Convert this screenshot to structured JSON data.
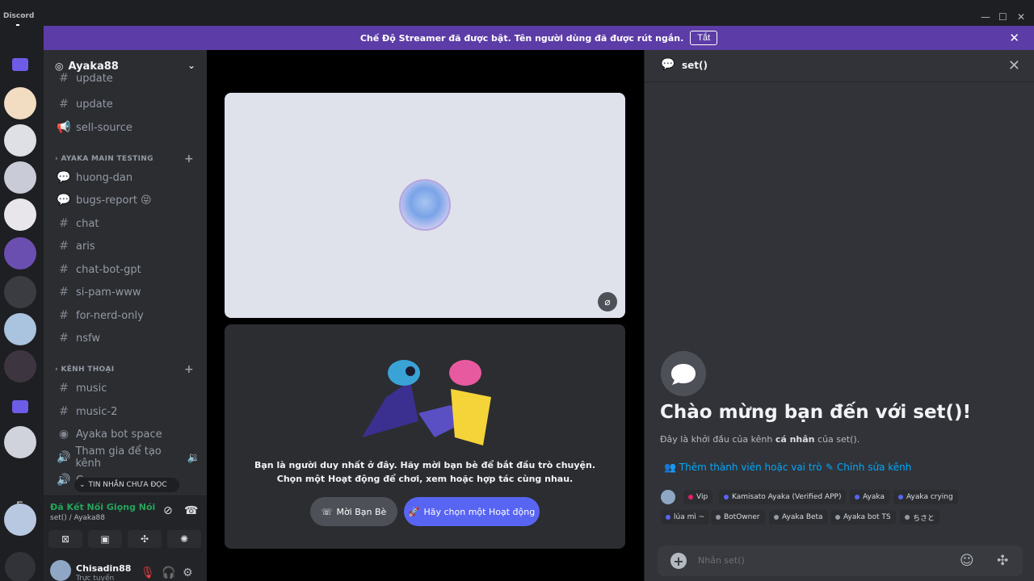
{
  "app": {
    "title": "Discord"
  },
  "banner": {
    "text": "Chế Độ Streamer đã được bật. Tên người dùng đã được rút ngắn.",
    "button": "Tắt"
  },
  "server": {
    "name": "Ayaka88"
  },
  "channels_top": [
    {
      "name": "update",
      "icon": "hash-icon"
    },
    {
      "name": "update",
      "icon": "hash-icon"
    },
    {
      "name": "sell-source",
      "icon": "announcement-icon"
    }
  ],
  "category1": {
    "label": "AYAKA MAIN TESTING"
  },
  "channels_main": [
    {
      "name": "huong-dan",
      "icon": "forum-icon"
    },
    {
      "name": "bugs-report 😝",
      "icon": "forum-icon"
    },
    {
      "name": "chat",
      "icon": "hash-icon"
    },
    {
      "name": "aris",
      "icon": "hash-icon"
    },
    {
      "name": "chat-bot-gpt",
      "icon": "hash-icon"
    },
    {
      "name": "si-pam-www",
      "icon": "hash-icon"
    },
    {
      "name": "for-nerd-only",
      "icon": "hash-icon"
    },
    {
      "name": "nsfw",
      "icon": "hash-icon"
    }
  ],
  "category2": {
    "label": "KÊNH THOẠI"
  },
  "channels_voice": [
    {
      "name": "music",
      "icon": "hash-icon"
    },
    {
      "name": "music-2",
      "icon": "hash-icon"
    },
    {
      "name": "Ayaka bot space",
      "icon": "stage-icon"
    },
    {
      "name": "Tham gia để tạo kênh",
      "icon": "speaker-icon"
    },
    {
      "name": "C...",
      "icon": "speaker-icon"
    }
  ],
  "unread_pill": "TIN NHẮN CHƯA ĐỌC",
  "voice": {
    "status": "Đã Kết Nối Giọng Nói",
    "location": "set() / Ayaka88"
  },
  "user": {
    "name": "Chisadin88",
    "status": "Trực tuyến"
  },
  "stage": {
    "invite_line1": "Bạn là người duy nhất ở đây. Hãy mời bạn bè để bắt đầu trò chuyện.",
    "invite_line2": "Chọn một Hoạt động để chơi, xem hoặc hợp tác cùng nhau.",
    "invite_button": "Mời Bạn Bè",
    "activity_button": "Hãy chọn một Hoạt động"
  },
  "chat": {
    "title": "set()",
    "welcome": "Chào mừng bạn đến với set()!",
    "welcome_sub_a": "Đây là khởi đầu của kênh ",
    "welcome_sub_b": "cá nhân",
    "welcome_sub_c": " của set().",
    "link_add": "Thêm thành viên hoặc vai trò",
    "link_edit": "Chỉnh sửa kênh",
    "placeholder": "Nhắn set()"
  },
  "roles": [
    {
      "name": "Vip",
      "color": "#e91e63"
    },
    {
      "name": "Kamisato Ayaka (Verified APP)",
      "color": "#5865f2"
    },
    {
      "name": "Ayaka",
      "color": "#5865f2"
    },
    {
      "name": "Ayaka crying",
      "color": "#5865f2"
    },
    {
      "name": "lúa mì ~",
      "color": "#5865f2"
    },
    {
      "name": "BotOwner",
      "color": "#949ba4"
    },
    {
      "name": "Ayaka Beta",
      "color": "#949ba4"
    },
    {
      "name": "Ayaka bot TS",
      "color": "#949ba4"
    },
    {
      "name": "ちさと",
      "color": "#949ba4"
    }
  ],
  "colors": {
    "accent": "#5865f2",
    "banner": "#5c3ca6",
    "online": "#23a55a",
    "link": "#00a8fc"
  }
}
